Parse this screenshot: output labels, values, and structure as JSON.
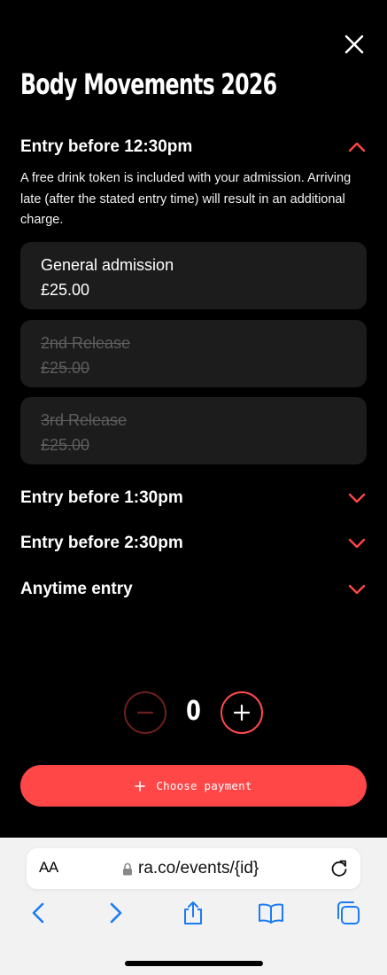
{
  "event": {
    "title": "Body Movements 2026"
  },
  "sections": [
    {
      "label": "Entry before 12:30pm",
      "expanded": true,
      "description": "A free drink token is included with your admission. Arriving late (after the stated entry time) will result in an additional charge.",
      "tickets": [
        {
          "name": "General admission",
          "price": "£25.00",
          "available": true
        },
        {
          "name": "2nd Release",
          "price": "£25.00",
          "available": false
        },
        {
          "name": "3rd Release",
          "price": "£25.00",
          "available": false
        }
      ]
    },
    {
      "label": "Entry before 1:30pm",
      "expanded": false
    },
    {
      "label": "Entry before 2:30pm",
      "expanded": false
    },
    {
      "label": "Anytime entry",
      "expanded": false
    }
  ],
  "quantity": {
    "count": "0"
  },
  "payment": {
    "label": "Choose payment"
  },
  "browser": {
    "text_size_label": "AA",
    "url": "ra.co/events/{id}"
  },
  "icons": {
    "close": "close-icon",
    "chevron_up": "chevron-up-icon",
    "chevron_down": "chevron-down-icon",
    "minus": "minus-icon",
    "plus": "plus-icon",
    "lock": "lock-icon",
    "reload": "reload-icon",
    "back": "back-icon",
    "forward": "forward-icon",
    "share": "share-icon",
    "bookmarks": "bookmarks-icon",
    "tabs": "tabs-icon"
  },
  "colors": {
    "accent": "#ff4747",
    "background": "#000000",
    "card": "#1c1c1c",
    "disabled_text": "#5e5e5e",
    "browser_blue": "#1a7cf5"
  }
}
